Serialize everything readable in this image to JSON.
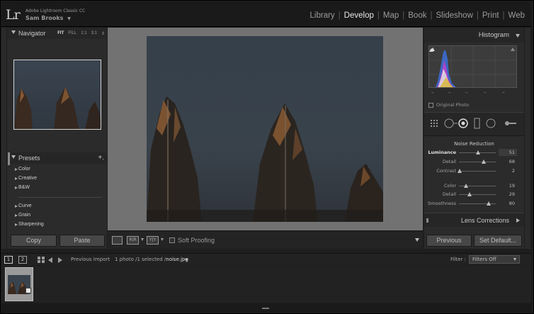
{
  "topbar": {
    "logo": "Lr",
    "app_name": "Adobe Lightroom Classic CC",
    "user_name": "Sam Brooks",
    "user_menu_arrow": "▼",
    "modules": [
      "Library",
      "Develop",
      "Map",
      "Book",
      "Slideshow",
      "Print",
      "Web"
    ],
    "active_module": "Develop"
  },
  "navigator": {
    "title": "Navigator",
    "zoom": [
      "FIT",
      "FILL",
      "1:1",
      "3:1"
    ],
    "zoom_selected": "FIT",
    "zoom_arrows": "⇕"
  },
  "presets": {
    "title": "Presets",
    "add_symbol": "+.",
    "groups_a": [
      "Color",
      "Creative",
      "B&W"
    ],
    "groups_b": [
      "Curve",
      "Grain",
      "Sharpening"
    ]
  },
  "left_buttons": {
    "copy": "Copy",
    "paste": "Paste"
  },
  "toolbar": {
    "loupe_icon": "loupe-view-icon",
    "before_after_label_1": "R|R",
    "before_after_label_2": "Y|Y",
    "soft_proofing": "Soft Proofing"
  },
  "histogram": {
    "title": "Histogram",
    "original_photo": "Original Photo",
    "readouts": [
      "--",
      "--",
      "--",
      "--",
      "--"
    ]
  },
  "noise_reduction": {
    "title": "Noise Reduction",
    "sliders_a": [
      {
        "label": "Luminance",
        "value": "51",
        "fraction": 0.51,
        "bold": true
      },
      {
        "label": "Detail",
        "value": "68",
        "fraction": 0.68,
        "bold": false
      },
      {
        "label": "Contrast",
        "value": "2",
        "fraction": 0.02,
        "bold": false
      }
    ],
    "sliders_b": [
      {
        "label": "Color",
        "value": "19",
        "fraction": 0.19,
        "bold": false
      },
      {
        "label": "Detail",
        "value": "29",
        "fraction": 0.29,
        "bold": false
      },
      {
        "label": "Smoothness",
        "value": "80",
        "fraction": 0.8,
        "bold": false
      }
    ]
  },
  "lens_corrections": {
    "title": "Lens Corrections"
  },
  "right_buttons": {
    "previous": "Previous",
    "set_default": "Set Default..."
  },
  "filmstrip_header": {
    "monitor1": "1",
    "monitor2": "2",
    "source": "Previous Import",
    "count_prefix": "1 photo /1 selected /",
    "filename": "noise.jpg",
    "filter_label": "Filter :",
    "filter_value": "Filters Off"
  }
}
